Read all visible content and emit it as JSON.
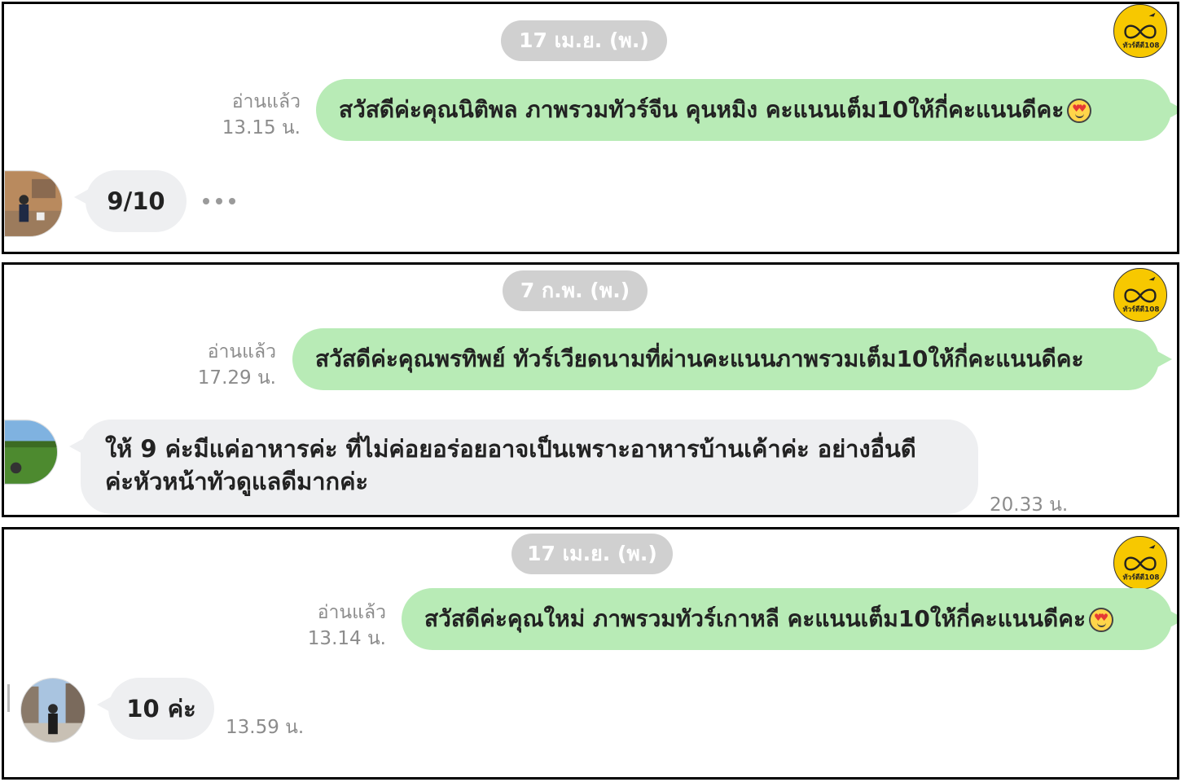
{
  "panel1": {
    "date": "17 เม.ย. (พ.)",
    "logo_text": "ทัวร์ดีดี108",
    "read_label": "อ่านแล้ว",
    "read_time": "13.15 น.",
    "sent_message": "สวัสดีค่ะคุณนิติพล ภาพรวมทัวร์จีน คุนหมิง  คะแนนเต็ม10ให้กี่คะแนนดีคะ",
    "sent_emoji": "heart-eyes-emoji",
    "reply": "9/10"
  },
  "panel2": {
    "date": "7 ก.พ. (พ.)",
    "logo_text": "ทัวร์ดีดี108",
    "read_label": "อ่านแล้ว",
    "read_time": "17.29 น.",
    "sent_message": "สวัสดีค่ะคุณพรทิพย์ ทัวร์เวียดนามที่ผ่านคะแนนภาพรวมเต็ม10ให้กี่คะแนนดีคะ",
    "reply_line1": "ให้ 9 ค่ะมีแค่อาหารค่ะ ที่ไม่ค่อยอร่อยอาจเป็นเพราะอาหารบ้านเค้าค่ะ อย่างอื่นดี",
    "reply_line2": "ค่ะหัวหน้าทัวดูแลดีมากค่ะ",
    "reply_time": "20.33 น."
  },
  "panel3": {
    "date": "17 เม.ย. (พ.)",
    "logo_text": "ทัวร์ดีดี108",
    "read_label": "อ่านแล้ว",
    "read_time": "13.14 น.",
    "sent_message": "สวัสดีค่ะคุณใหม่ ภาพรวมทัวร์เกาหลี คะแนนเต็ม10ให้กี่คะแนนดีคะ",
    "sent_emoji": "heart-eyes-emoji",
    "reply": "10 ค่ะ",
    "reply_time": "13.59 น."
  },
  "colors": {
    "sent_bubble": "#b8ebb6",
    "received_bubble": "#eeeff1",
    "date_pill": "#d0d0d0",
    "logo_yellow": "#f7c800"
  }
}
